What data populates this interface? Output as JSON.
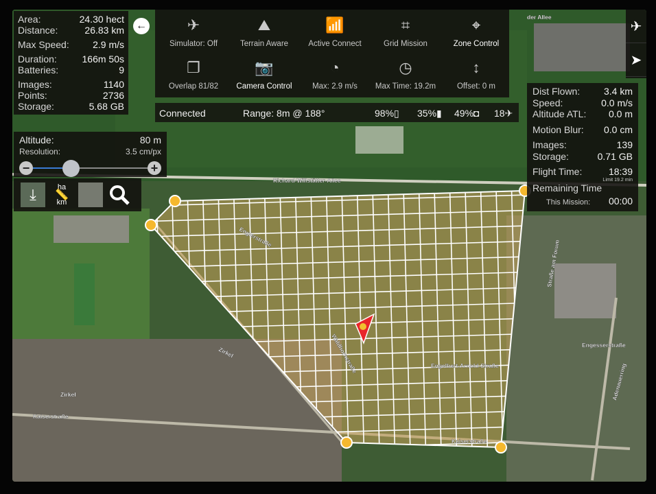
{
  "mission_stats": {
    "area": {
      "label": "Area:",
      "value": "24.30 hect"
    },
    "distance": {
      "label": "Distance:",
      "value": "26.83 km"
    },
    "max_speed": {
      "label": "Max Speed:",
      "value": "2.9 m/s"
    },
    "duration": {
      "label": "Duration:",
      "value": "166m 50s"
    },
    "batteries": {
      "label": "Batteries:",
      "value": "9"
    },
    "images": {
      "label": "Images:",
      "value": "1140"
    },
    "points": {
      "label": "Points:",
      "value": "2736"
    },
    "storage": {
      "label": "Storage:",
      "value": "5.68 GB"
    }
  },
  "altitude_panel": {
    "altitude_label": "Altitude:",
    "altitude_value": "80 m",
    "resolution_label": "Resolution:",
    "resolution_value": "3.5 cm/px",
    "slider_fraction": 0.33
  },
  "tools": [
    {
      "name": "save-mission-icon"
    },
    {
      "name": "units-ha-km-icon",
      "top": "ha",
      "bottom": "km"
    },
    {
      "name": "map-type-icon"
    },
    {
      "name": "search-icon"
    }
  ],
  "top_menu": [
    {
      "label": "Simulator: Off",
      "icon": "airplane-icon",
      "active": false
    },
    {
      "label": "Terrain Aware",
      "icon": "mountain-icon",
      "active": false
    },
    {
      "label": "Active Connect",
      "icon": "antenna-icon",
      "active": false
    },
    {
      "label": "Grid Mission",
      "icon": "grid-icon",
      "active": false
    },
    {
      "label": "Zone Control",
      "icon": "location-pin-icon",
      "active": true
    },
    {
      "label": "Overlap 81/82",
      "icon": "overlap-icon",
      "active": false
    },
    {
      "label": "Camera Control",
      "icon": "camera-icon",
      "active": true
    },
    {
      "label": "Max: 2.9 m/s",
      "icon": "speedometer-icon",
      "active": false
    },
    {
      "label": "Max Time: 19.2m",
      "icon": "clock-icon",
      "active": false
    },
    {
      "label": "Offset: 0 m",
      "icon": "up-down-arrows-icon",
      "active": false
    }
  ],
  "status_bar": {
    "connection": "Connected",
    "range": "Range: 8m @ 188°",
    "device_battery": "98%",
    "controller_battery": "35%",
    "drone_battery": "49%",
    "satellites": "18"
  },
  "flight_stats": {
    "dist_flown": {
      "label": "Dist Flown:",
      "value": "3.4 km"
    },
    "speed": {
      "label": "Speed:",
      "value": "0.0 m/s"
    },
    "altitude_atl": {
      "label": "Altitude ATL:",
      "value": "0.0 m"
    },
    "motion_blur": {
      "label": "Motion Blur:",
      "value": "0.0 cm"
    },
    "images": {
      "label": "Images:",
      "value": "139"
    },
    "storage": {
      "label": "Storage:",
      "value": "0.71 GB"
    },
    "flight_time": {
      "label": "Flight Time:",
      "value": "18:39"
    },
    "limit": "Limit 19.2 min",
    "remaining_label": "Remaining Time",
    "this_mission": {
      "label": "This Mission:",
      "value": "00:00"
    }
  },
  "map": {
    "streets": [
      "Richard-Willstätter-Allee",
      "Zirkel",
      "Zirkel",
      "Kaiserstraße",
      "Engesserstraße",
      "Engelbert-Arnold-Straße",
      "Adenauerring",
      "Englerstraße",
      "Straße am Forum",
      "Kaiserstraße",
      "Waldhornstraße",
      "der Allee"
    ],
    "colors": {
      "grid": "#ffffff",
      "zone": "#e89a2a",
      "waypoint": "#f5b82e",
      "drone": "#e8262a"
    }
  }
}
